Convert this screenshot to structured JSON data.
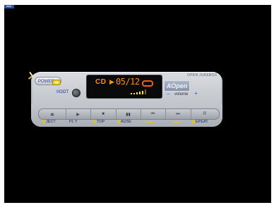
{
  "player": {
    "power_label": "POWER",
    "boot_label_first": "B",
    "boot_label_rest": "OOT",
    "lcd": {
      "source": "CD",
      "play_arrow": "▶",
      "track": "05/12"
    },
    "brand": "AOpen",
    "model": "OPEN JUKEBOX",
    "volume_label": "volume",
    "volume_minus": "−",
    "volume_plus": "+",
    "buttons": [
      {
        "name": "eject",
        "glyph": "⏏",
        "label": "JECT"
      },
      {
        "name": "play",
        "glyph": "▶",
        "label": "PL Y"
      },
      {
        "name": "stop",
        "glyph": "■",
        "label": "TOP"
      },
      {
        "name": "pause",
        "glyph": "▮▮",
        "label": "AUSE"
      },
      {
        "name": "previous",
        "glyph": "⏮",
        "label": ""
      },
      {
        "name": "next",
        "glyph": "⏭",
        "label": ""
      },
      {
        "name": "repeat",
        "glyph": "R",
        "label": "EPEAT"
      }
    ],
    "colors": {
      "lcd_text": "#ff8f0f",
      "power_led": "#e3b400",
      "accent_blue": "#2d4fd0"
    }
  }
}
